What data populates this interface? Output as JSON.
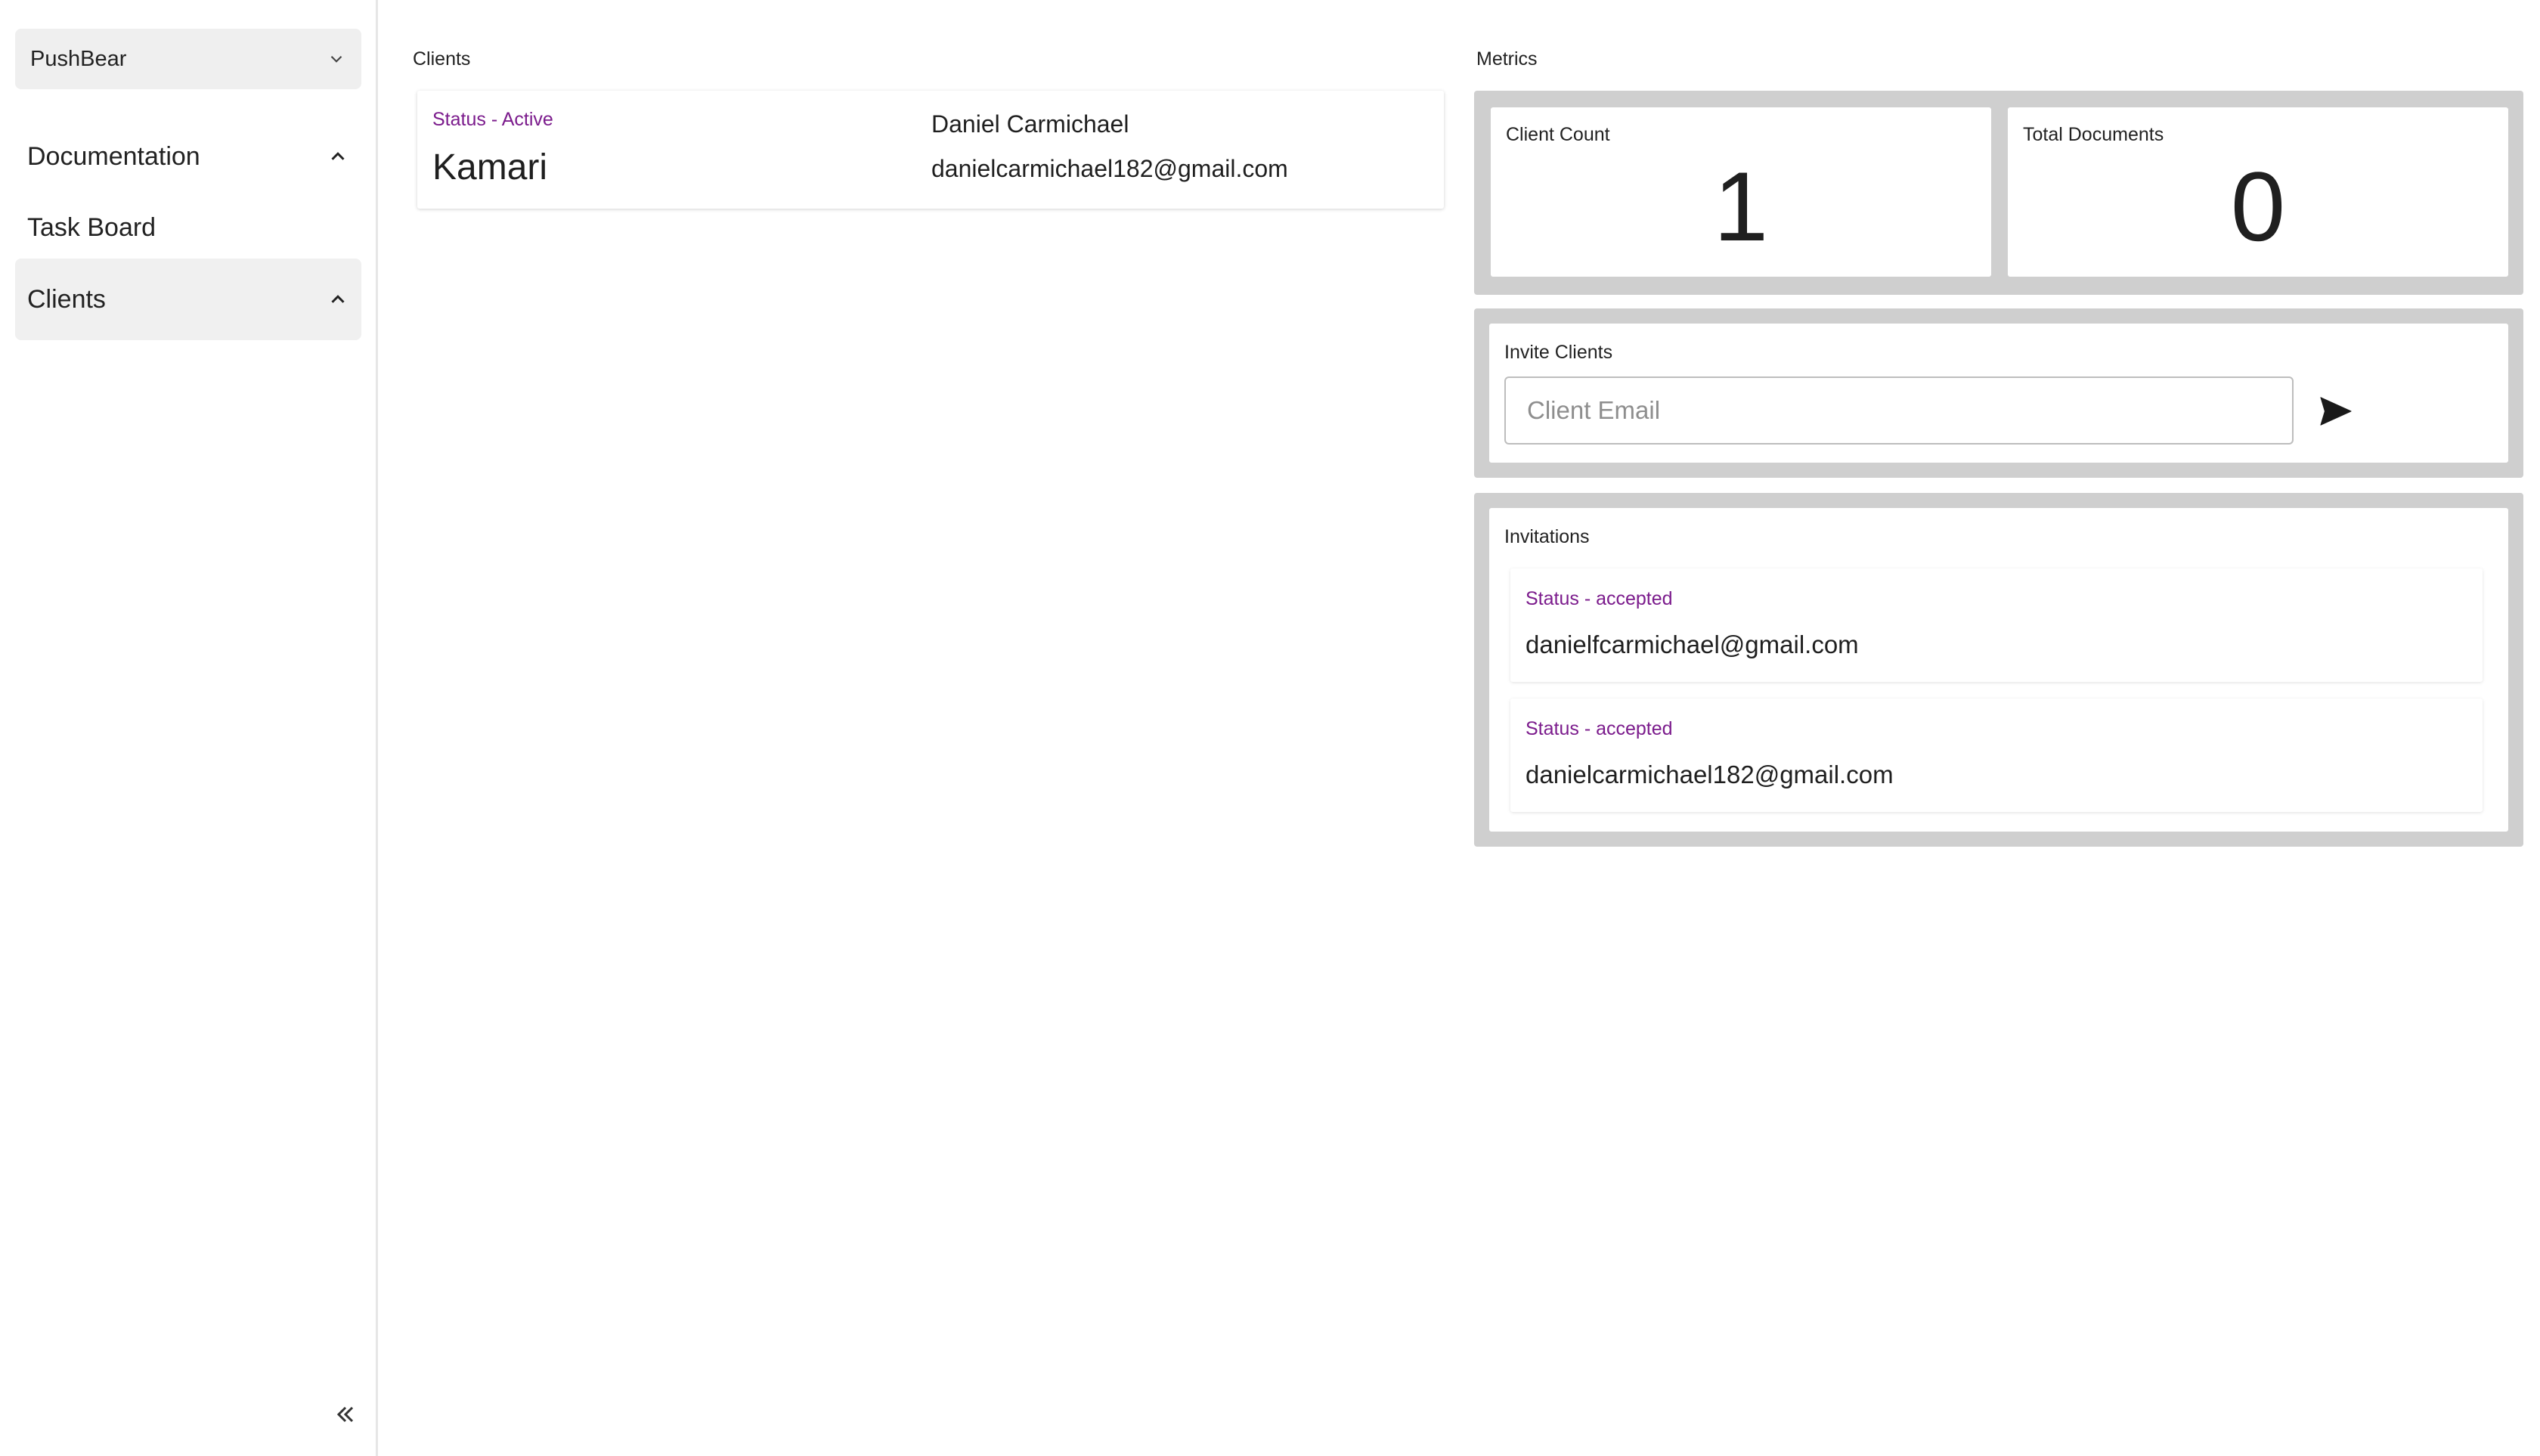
{
  "sidebar": {
    "workspace": {
      "label": "PushBear",
      "icon": "chevron-down-icon"
    },
    "items": [
      {
        "label": "Documentation",
        "icon": "chevron-up-icon"
      },
      {
        "label": "Task Board"
      },
      {
        "label": "Clients",
        "icon": "chevron-up-icon",
        "selected": true
      }
    ],
    "collapse_icon": "double-chevron-left-icon"
  },
  "clients": {
    "title": "Clients",
    "cards": [
      {
        "status": "Status - Active",
        "name": "Kamari",
        "contact_name": "Daniel Carmichael",
        "contact_email": "danielcarmichael182@gmail.com"
      }
    ]
  },
  "metrics": {
    "title": "Metrics",
    "client_count_label": "Client Count",
    "client_count": "1",
    "total_documents_label": "Total Documents",
    "total_documents": "0"
  },
  "invite": {
    "label": "Invite Clients",
    "placeholder": "Client Email",
    "value": "",
    "send_icon": "send-icon"
  },
  "invitations": {
    "label": "Invitations",
    "items": [
      {
        "status": "Status - accepted",
        "email": "danielfcarmichael@gmail.com"
      },
      {
        "status": "Status - accepted",
        "email": "danielcarmichael182@gmail.com"
      }
    ]
  },
  "colors": {
    "status_purple": "#7b1b8c",
    "panel_gray": "#cfcfcf",
    "selected_bg": "#f0f0f0"
  }
}
